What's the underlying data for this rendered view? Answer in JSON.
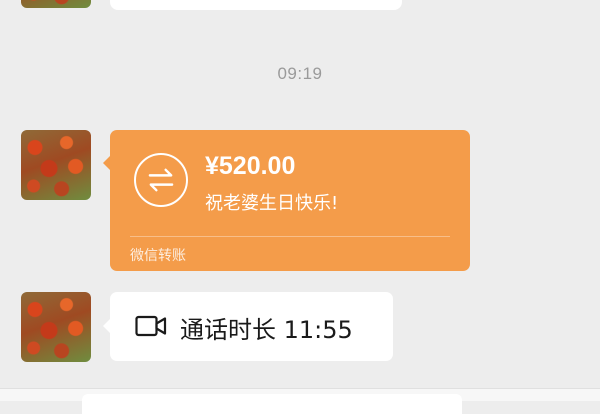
{
  "chat": {
    "timestamp": "09:19",
    "transfer": {
      "amount": "¥520.00",
      "note": "祝老婆生日快乐!",
      "source": "微信转账",
      "bubble_color": "#f49c4a",
      "icon": "transfer-arrows-icon"
    },
    "call": {
      "text": "通话时长 11:55",
      "icon": "video-call-icon"
    }
  }
}
